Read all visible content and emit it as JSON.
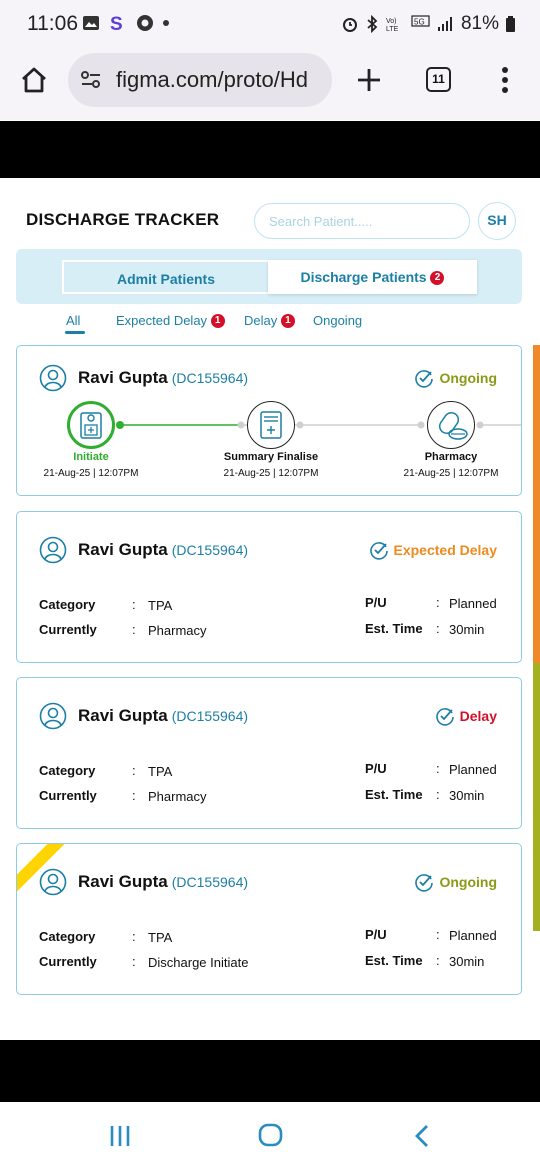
{
  "status_bar": {
    "time": "11:06",
    "battery": "81%",
    "network": "5G"
  },
  "browser": {
    "url": "figma.com/proto/Hd",
    "tab_count": "11"
  },
  "app": {
    "title": "DISCHARGE TRACKER",
    "search_placeholder": "Search Patient.....",
    "user_initials": "SH",
    "toggle": {
      "admit_label": "Admit Patients",
      "discharge_label": "Discharge Patients",
      "discharge_badge": "2",
      "selected": "Discharge Patients"
    },
    "filters": [
      {
        "label": "All",
        "badge": ""
      },
      {
        "label": "Expected Delay",
        "badge": "1"
      },
      {
        "label": "Delay",
        "badge": "1"
      },
      {
        "label": "Ongoing",
        "badge": ""
      }
    ],
    "active_filter": "All",
    "colors": {
      "primary": "#1c7fa6",
      "ongoing": "#8a9a17",
      "expected_delay": "#ee8a1f",
      "delay": "#d2102a",
      "active_stage": "#2fae2f",
      "ribbon": "#ffd400"
    }
  },
  "cards": [
    {
      "name": "Ravi Gupta",
      "id": "(DC155964)",
      "status": "Ongoing",
      "stages": [
        {
          "label": "Initiate",
          "date": "21-Aug-25 | 12:07PM",
          "icon": "clipboard-add-icon",
          "active": true
        },
        {
          "label": "Summary Finalise",
          "date": "21-Aug-25 | 12:07PM",
          "icon": "document-add-icon",
          "active": false
        },
        {
          "label": "Pharmacy",
          "date": "21-Aug-25 | 12:07PM",
          "icon": "pills-icon",
          "active": false
        }
      ]
    },
    {
      "name": "Ravi Gupta",
      "id": "(DC155964)",
      "status": "Expected Delay",
      "category_label": "Category",
      "category": "TPA",
      "currently_label": "Currently",
      "currently": "Pharmacy",
      "pu_label": "P/U",
      "pu": "Planned",
      "est_label": "Est. Time",
      "est_time": "30min"
    },
    {
      "name": "Ravi Gupta",
      "id": "(DC155964)",
      "status": "Delay",
      "category_label": "Category",
      "category": "TPA",
      "currently_label": "Currently",
      "currently": "Pharmacy",
      "pu_label": "P/U",
      "pu": "Planned",
      "est_label": "Est. Time",
      "est_time": "30min"
    },
    {
      "name": "Ravi Gupta",
      "id": "(DC155964)",
      "status": "Ongoing",
      "category_label": "Category",
      "category": "TPA",
      "currently_label": "Currently",
      "currently": "Discharge Initiate",
      "pu_label": "P/U",
      "pu": "Planned",
      "est_label": "Est. Time",
      "est_time": "30min"
    }
  ],
  "colon": ":"
}
